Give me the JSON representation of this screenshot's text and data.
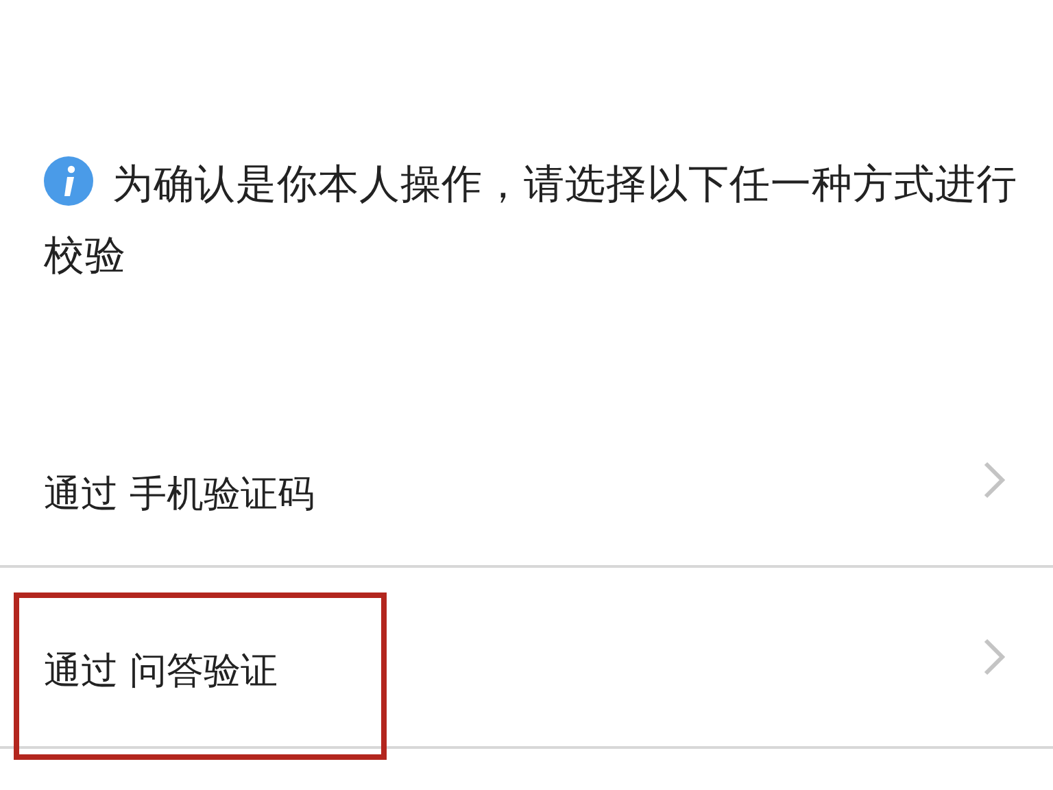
{
  "notice": {
    "text": "为确认是你本人操作，请选择以下任一种方式进行校验"
  },
  "options": [
    {
      "label": "通过 手机验证码",
      "highlighted": false
    },
    {
      "label": "通过 问答验证",
      "highlighted": true
    }
  ]
}
